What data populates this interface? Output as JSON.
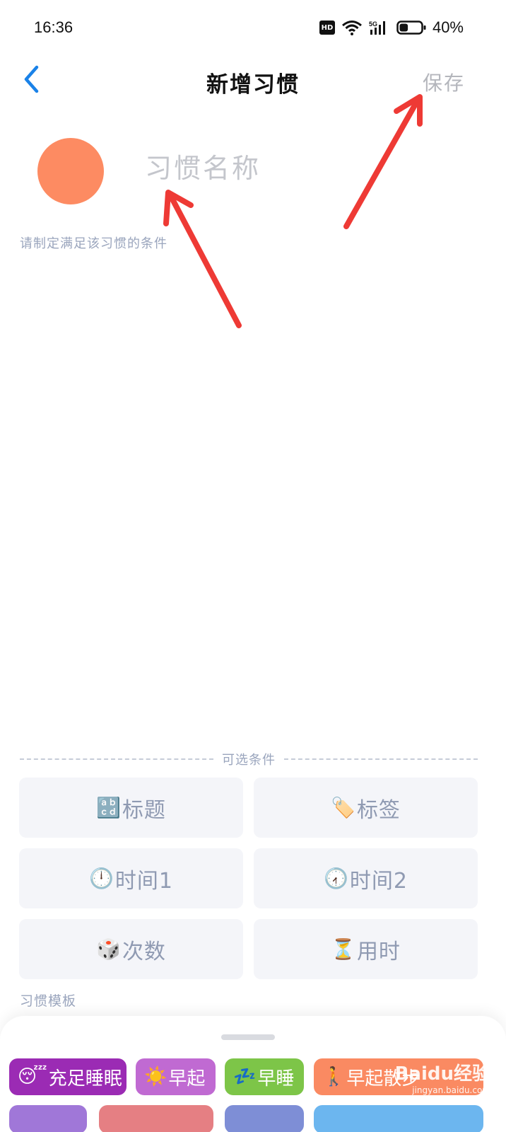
{
  "status_bar": {
    "time": "16:36",
    "hd_badge": "HD",
    "network": "5G",
    "battery_percent": "40%",
    "battery_level": 0.4
  },
  "nav": {
    "back_icon": "chevron-left-icon",
    "title": "新增习惯",
    "save_label": "保存"
  },
  "habit": {
    "color": "#fd8b62",
    "name_placeholder": "习惯名称",
    "condition_hint": "请制定满足该习惯的条件"
  },
  "optional_conditions": {
    "label": "可选条件",
    "items": [
      {
        "icon": "🔡",
        "label": "标题"
      },
      {
        "icon": "🏷️",
        "label": "标签"
      },
      {
        "icon": "🕛",
        "label": "时间1"
      },
      {
        "icon": "🕢",
        "label": "时间2"
      },
      {
        "icon": "🎲",
        "label": "次数"
      },
      {
        "icon": "⏳",
        "label": "用时"
      }
    ]
  },
  "templates": {
    "label": "习惯模板",
    "chips": [
      {
        "icon": "😴",
        "label": "充足睡眠",
        "color": "#9b2bb4"
      },
      {
        "icon": "☀️",
        "label": "早起",
        "color": "#c06ad2"
      },
      {
        "icon": "💤",
        "label": "早睡",
        "color": "#7dc548"
      },
      {
        "icon": "🚶",
        "label": "早起散步",
        "color": "#fa8a62"
      }
    ]
  },
  "watermark": {
    "main": "Baidu经验",
    "sub": "jingyan.baidu.com"
  },
  "annotation_color": "#ee3a35"
}
